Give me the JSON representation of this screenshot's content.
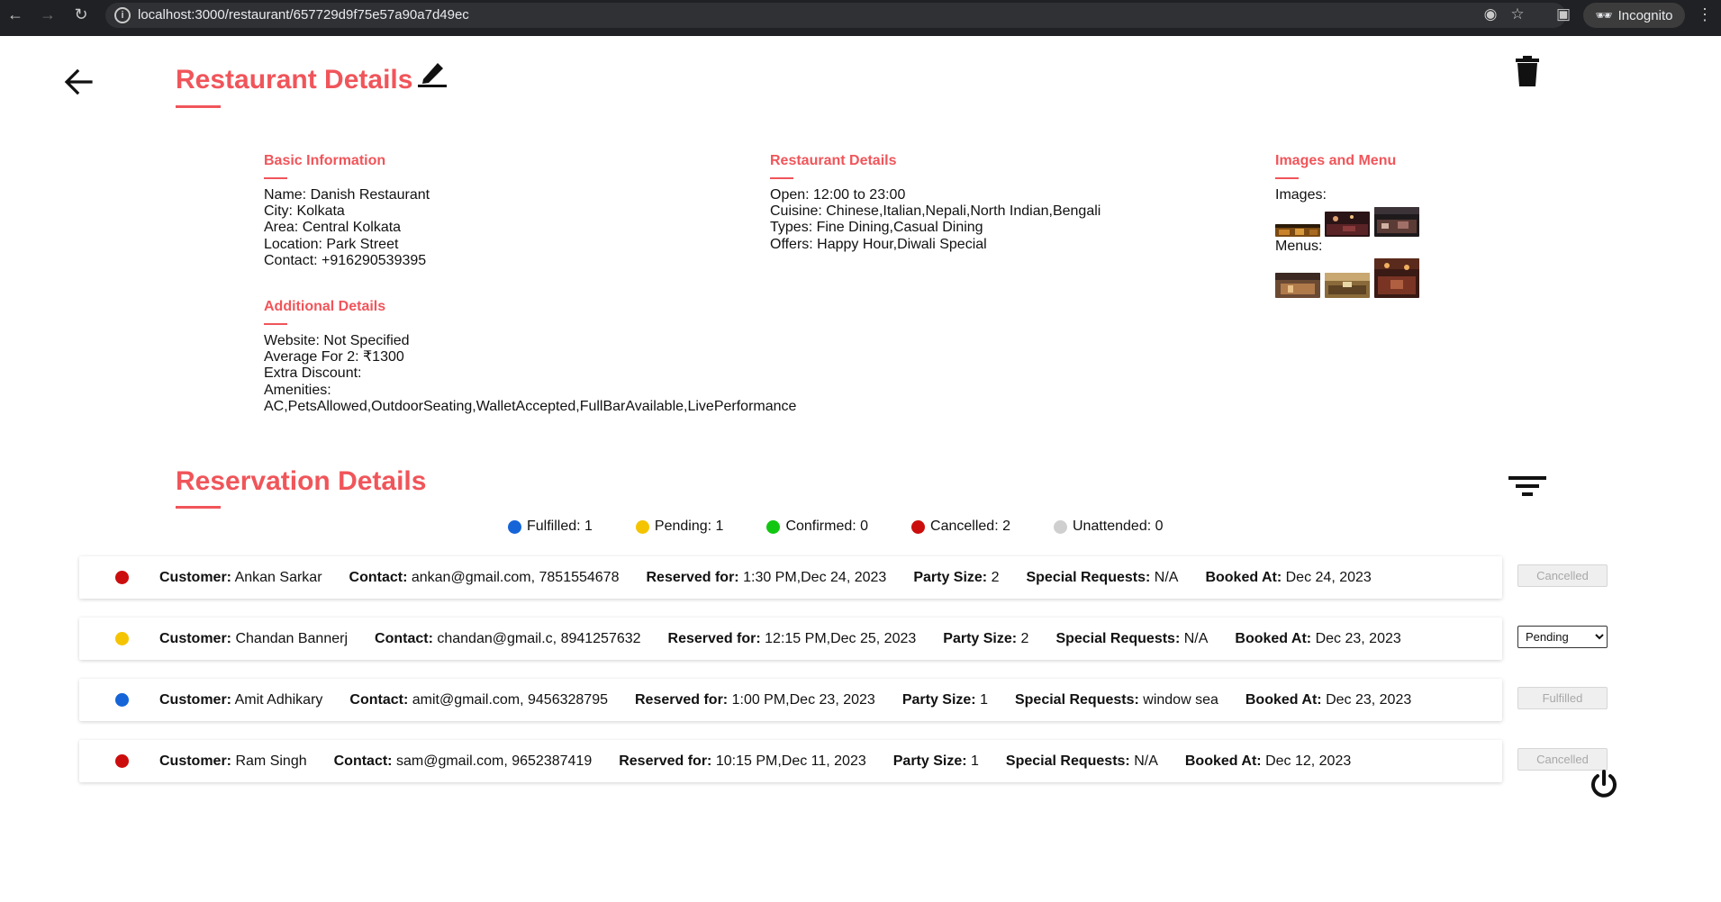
{
  "browser": {
    "url": "localhost:3000/restaurant/657729d9f75e57a90a7d49ec",
    "incognito_label": "Incognito"
  },
  "page": {
    "title": "Restaurant Details",
    "reservations_title": "Reservation Details"
  },
  "basic_info": {
    "heading": "Basic Information",
    "name": "Name: Danish Restaurant",
    "city": "City: Kolkata",
    "area": "Area: Central Kolkata",
    "location": "Location: Park Street",
    "contact": "Contact: +916290539395"
  },
  "restaurant_details": {
    "heading": "Restaurant Details",
    "open": "Open: 12:00 to 23:00",
    "cuisine": "Cuisine: Chinese,Italian,Nepali,North Indian,Bengali",
    "types": "Types: Fine Dining,Casual Dining",
    "offers": "Offers: Happy Hour,Diwali Special"
  },
  "images_menu": {
    "heading": "Images and Menu",
    "images_label": "Images:",
    "menus_label": "Menus:"
  },
  "additional": {
    "heading": "Additional Details",
    "website": "Website: Not Specified",
    "average": "Average For 2: ₹1300",
    "discount": "Extra Discount:",
    "amenities_label": "Amenities:",
    "amenities": "AC,PetsAllowed,OutdoorSeating,WalletAccepted,FullBarAvailable,LivePerformance"
  },
  "legend": [
    {
      "label": "Fulfilled: 1",
      "color": "#1565d8"
    },
    {
      "label": "Pending: 1",
      "color": "#f5c400"
    },
    {
      "label": "Confirmed: 0",
      "color": "#12c712"
    },
    {
      "label": "Cancelled: 2",
      "color": "#cc0d0d"
    },
    {
      "label": "Unattended: 0",
      "color": "#cfcfcf"
    }
  ],
  "labels": {
    "customer": "Customer:",
    "contact": "Contact:",
    "reserved_for": "Reserved for:",
    "party_size": "Party Size:",
    "special_requests": "Special Requests:",
    "booked_at": "Booked At:"
  },
  "reservations": [
    {
      "status_color": "#cc0d0d",
      "customer": "Ankan Sarkar",
      "contact": "ankan@gmail.com, 7851554678",
      "reserved_for": "1:30 PM,Dec 24, 2023",
      "party_size": "2",
      "special_requests": "N/A",
      "booked_at": "Dec 24, 2023",
      "status": "Cancelled"
    },
    {
      "status_color": "#f5c400",
      "customer": "Chandan Bannerj",
      "contact": "chandan@gmail.c, 8941257632",
      "reserved_for": "12:15 PM,Dec 25, 2023",
      "party_size": "2",
      "special_requests": "N/A",
      "booked_at": "Dec 23, 2023",
      "status": "Pending"
    },
    {
      "status_color": "#1565d8",
      "customer": "Amit Adhikary",
      "contact": "amit@gmail.com, 9456328795",
      "reserved_for": "1:00 PM,Dec 23, 2023",
      "party_size": "1",
      "special_requests": "window sea",
      "booked_at": "Dec 23, 2023",
      "status": "Fulfilled"
    },
    {
      "status_color": "#cc0d0d",
      "customer": "Ram Singh",
      "contact": "sam@gmail.com, 9652387419",
      "reserved_for": "10:15 PM,Dec 11, 2023",
      "party_size": "1",
      "special_requests": "N/A",
      "booked_at": "Dec 12, 2023",
      "status": "Cancelled"
    }
  ]
}
